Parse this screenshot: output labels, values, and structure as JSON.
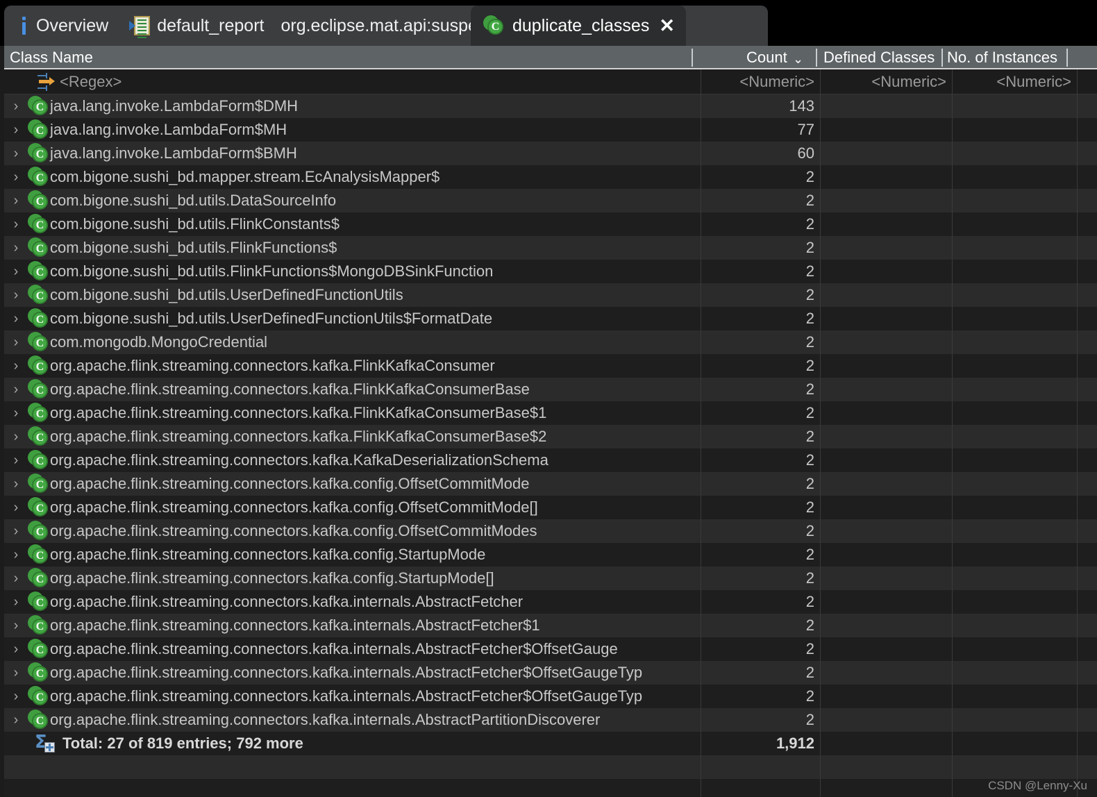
{
  "window": {
    "accent_green": "#43a843",
    "accent_blue": "#4a90e2",
    "header_bg": "#5e6365",
    "row_odd_bg": "#2b2b2b",
    "row_even_bg": "#1e1e1e"
  },
  "tabs": [
    {
      "label": "Overview",
      "icon": "info-icon",
      "active": false
    },
    {
      "label": "default_report",
      "icon": "report-icon",
      "active": false
    },
    {
      "label": "org.eclipse.mat.api:suspects",
      "icon": "none",
      "active": false
    },
    {
      "label": "duplicate_classes",
      "icon": "class-icon",
      "active": true,
      "close_label": "✕"
    }
  ],
  "table": {
    "columns": [
      {
        "key": "class_name",
        "label": "Class Name",
        "align": "left",
        "filter": "<Regex>",
        "filter_icon": "regex-filter-icon"
      },
      {
        "key": "count",
        "label": "Count",
        "align": "right",
        "filter": "<Numeric>",
        "sorted": true,
        "sort_dir": "desc",
        "sort_glyph": "⌄"
      },
      {
        "key": "defined_classes",
        "label": "Defined Classes",
        "align": "right",
        "filter": "<Numeric>"
      },
      {
        "key": "no_of_instances",
        "label": "No. of Instances",
        "align": "right",
        "filter": "<Numeric>"
      }
    ],
    "expand_glyph": "›",
    "row_icon": "class-icon",
    "rows": [
      {
        "class_name": "java.lang.invoke.LambdaForm$DMH",
        "count": "143",
        "defined_classes": "",
        "no_of_instances": ""
      },
      {
        "class_name": "java.lang.invoke.LambdaForm$MH",
        "count": "77",
        "defined_classes": "",
        "no_of_instances": ""
      },
      {
        "class_name": "java.lang.invoke.LambdaForm$BMH",
        "count": "60",
        "defined_classes": "",
        "no_of_instances": ""
      },
      {
        "class_name": "com.bigone.sushi_bd.mapper.stream.EcAnalysisMapper$",
        "count": "2",
        "defined_classes": "",
        "no_of_instances": ""
      },
      {
        "class_name": "com.bigone.sushi_bd.utils.DataSourceInfo",
        "count": "2",
        "defined_classes": "",
        "no_of_instances": ""
      },
      {
        "class_name": "com.bigone.sushi_bd.utils.FlinkConstants$",
        "count": "2",
        "defined_classes": "",
        "no_of_instances": ""
      },
      {
        "class_name": "com.bigone.sushi_bd.utils.FlinkFunctions$",
        "count": "2",
        "defined_classes": "",
        "no_of_instances": ""
      },
      {
        "class_name": "com.bigone.sushi_bd.utils.FlinkFunctions$MongoDBSinkFunction",
        "count": "2",
        "defined_classes": "",
        "no_of_instances": ""
      },
      {
        "class_name": "com.bigone.sushi_bd.utils.UserDefinedFunctionUtils",
        "count": "2",
        "defined_classes": "",
        "no_of_instances": ""
      },
      {
        "class_name": "com.bigone.sushi_bd.utils.UserDefinedFunctionUtils$FormatDate",
        "count": "2",
        "defined_classes": "",
        "no_of_instances": ""
      },
      {
        "class_name": "com.mongodb.MongoCredential",
        "count": "2",
        "defined_classes": "",
        "no_of_instances": ""
      },
      {
        "class_name": "org.apache.flink.streaming.connectors.kafka.FlinkKafkaConsumer",
        "count": "2",
        "defined_classes": "",
        "no_of_instances": ""
      },
      {
        "class_name": "org.apache.flink.streaming.connectors.kafka.FlinkKafkaConsumerBase",
        "count": "2",
        "defined_classes": "",
        "no_of_instances": ""
      },
      {
        "class_name": "org.apache.flink.streaming.connectors.kafka.FlinkKafkaConsumerBase$1",
        "count": "2",
        "defined_classes": "",
        "no_of_instances": ""
      },
      {
        "class_name": "org.apache.flink.streaming.connectors.kafka.FlinkKafkaConsumerBase$2",
        "count": "2",
        "defined_classes": "",
        "no_of_instances": ""
      },
      {
        "class_name": "org.apache.flink.streaming.connectors.kafka.KafkaDeserializationSchema",
        "count": "2",
        "defined_classes": "",
        "no_of_instances": ""
      },
      {
        "class_name": "org.apache.flink.streaming.connectors.kafka.config.OffsetCommitMode",
        "count": "2",
        "defined_classes": "",
        "no_of_instances": ""
      },
      {
        "class_name": "org.apache.flink.streaming.connectors.kafka.config.OffsetCommitMode[]",
        "count": "2",
        "defined_classes": "",
        "no_of_instances": ""
      },
      {
        "class_name": "org.apache.flink.streaming.connectors.kafka.config.OffsetCommitModes",
        "count": "2",
        "defined_classes": "",
        "no_of_instances": ""
      },
      {
        "class_name": "org.apache.flink.streaming.connectors.kafka.config.StartupMode",
        "count": "2",
        "defined_classes": "",
        "no_of_instances": ""
      },
      {
        "class_name": "org.apache.flink.streaming.connectors.kafka.config.StartupMode[]",
        "count": "2",
        "defined_classes": "",
        "no_of_instances": ""
      },
      {
        "class_name": "org.apache.flink.streaming.connectors.kafka.internals.AbstractFetcher",
        "count": "2",
        "defined_classes": "",
        "no_of_instances": ""
      },
      {
        "class_name": "org.apache.flink.streaming.connectors.kafka.internals.AbstractFetcher$1",
        "count": "2",
        "defined_classes": "",
        "no_of_instances": ""
      },
      {
        "class_name": "org.apache.flink.streaming.connectors.kafka.internals.AbstractFetcher$OffsetGauge",
        "count": "2",
        "defined_classes": "",
        "no_of_instances": ""
      },
      {
        "class_name": "org.apache.flink.streaming.connectors.kafka.internals.AbstractFetcher$OffsetGaugeTyp",
        "count": "2",
        "defined_classes": "",
        "no_of_instances": ""
      },
      {
        "class_name": "org.apache.flink.streaming.connectors.kafka.internals.AbstractFetcher$OffsetGaugeTyp",
        "count": "2",
        "defined_classes": "",
        "no_of_instances": ""
      },
      {
        "class_name": "org.apache.flink.streaming.connectors.kafka.internals.AbstractPartitionDiscoverer",
        "count": "2",
        "defined_classes": "",
        "no_of_instances": ""
      }
    ],
    "total": {
      "icon": "sigma-total-icon",
      "label": "Total: 27 of 819 entries; 792 more",
      "count": "1,912",
      "defined_classes": "",
      "no_of_instances": ""
    }
  },
  "watermark": "CSDN @Lenny-Xu"
}
